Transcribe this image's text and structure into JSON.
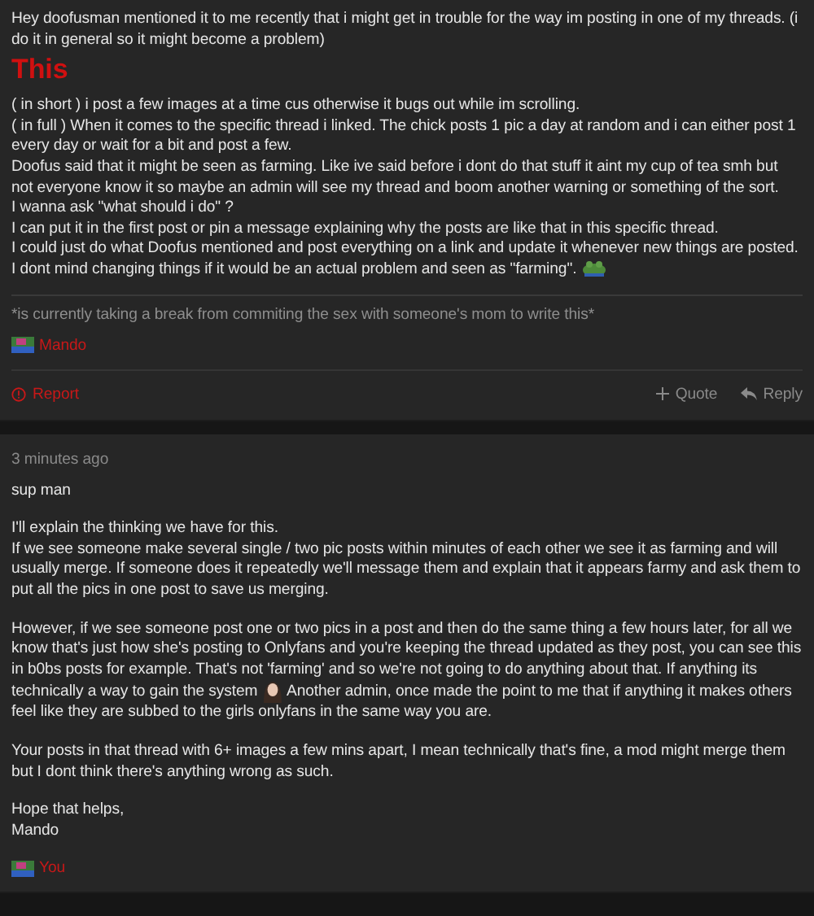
{
  "posts": [
    {
      "blocks": [
        {
          "kind": "paragraph",
          "lines": [
            {
              "kind": "text",
              "text": "Hey doofusman mentioned it to me recently that i might get in trouble for the way im posting in one of my threads. (i do it in general so it might become a problem)"
            }
          ]
        },
        {
          "kind": "heading",
          "text": "This"
        },
        {
          "kind": "paragraph",
          "lines": [
            {
              "kind": "text",
              "text": "( in short ) i post a few images at a time cus otherwise it bugs out while im scrolling."
            },
            {
              "kind": "text",
              "text": "( in full ) When it comes to the specific thread i linked. The chick posts 1 pic a day at random and i can either post 1 every day or wait for a bit and post a few."
            },
            {
              "kind": "text",
              "text": "Doofus said that it might be seen as farming. Like ive said before i dont do that stuff it aint my cup of tea smh but not everyone know it so maybe an admin will see my thread and boom another warning or something of the sort."
            },
            {
              "kind": "text",
              "text": "I wanna ask \"what should i do\" ?"
            },
            {
              "kind": "text",
              "text": "I can put it in the first post or pin a message explaining why the posts are like that in this specific thread."
            },
            {
              "kind": "text",
              "text": "I could just do what Doofus mentioned and post everything on a link and update it whenever new things are posted."
            },
            {
              "kind": "emoji_end",
              "text": "I dont mind changing things if it would be an actual problem and seen as \"farming\"."
            }
          ]
        }
      ],
      "signature": {
        "quote": "*is currently taking a break from commiting the sex with someone's mom to write this*",
        "name": "Mando"
      },
      "actions": {
        "report": "Report",
        "quote": "Quote",
        "reply": "Reply"
      }
    },
    {
      "timestamp": "3 minutes ago",
      "blocks": [
        {
          "kind": "paragraph",
          "lines": [
            {
              "kind": "text",
              "text": "sup man"
            }
          ]
        },
        {
          "kind": "paragraph",
          "lines": [
            {
              "kind": "text",
              "text": "I'll explain the thinking we have for this."
            },
            {
              "kind": "text",
              "text": "If we see someone make several single / two pic posts within minutes of each other we see it as farming and will usually merge. If someone does it repeatedly we'll message them and explain that it appears farmy and ask them to put all the pics in one post to save us merging."
            }
          ]
        },
        {
          "kind": "paragraph",
          "lines": [
            {
              "kind": "emoji_mid",
              "text": "However, if we see someone post one or two pics in a post and then do the same thing a few hours later, for all we know that's just how she's posting to Onlyfans and you're keeping the thread updated as they post, you can see this in b0bs posts for example. That's not 'farming' and so we're not going to do anything about that. If anything its technically a way to gain the system",
              "after": "Another admin, once made the point to me that if anything it makes others feel like they are subbed to the girls onlyfans in the same way you are."
            }
          ]
        },
        {
          "kind": "paragraph",
          "lines": [
            {
              "kind": "text",
              "text": "Your posts in that thread with 6+ images a few mins apart, I mean technically that's fine, a mod might merge them but I dont think there's anything wrong as such."
            }
          ]
        },
        {
          "kind": "paragraph",
          "lines": [
            {
              "kind": "text",
              "text": "Hope that helps,"
            },
            {
              "kind": "text",
              "text": "Mando"
            }
          ]
        }
      ],
      "signature": {
        "name": "You"
      }
    }
  ]
}
